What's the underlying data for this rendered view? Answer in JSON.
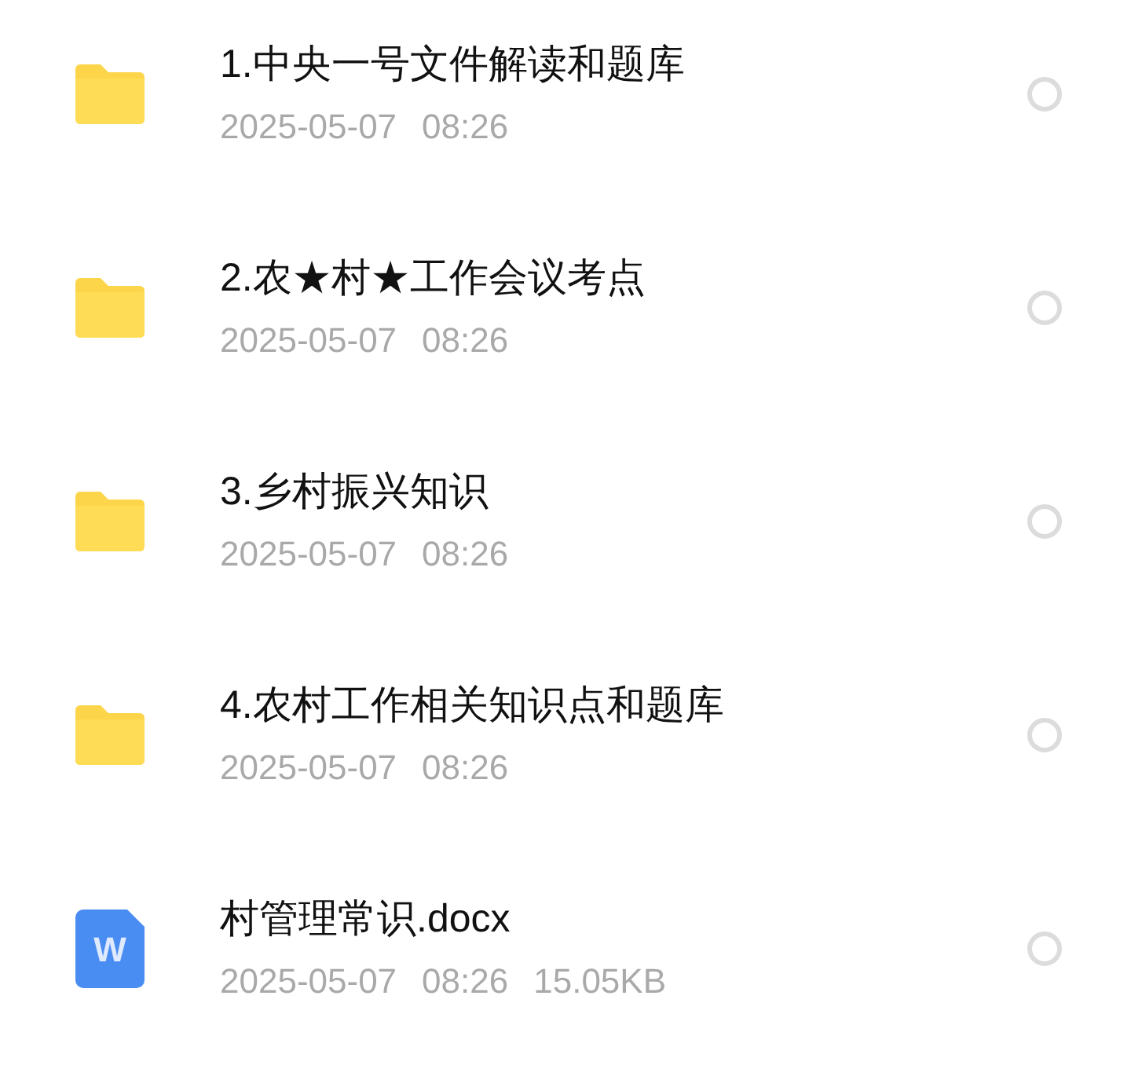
{
  "files": [
    {
      "kind": "folder",
      "name": "1.中央一号文件解读和题库",
      "date": "2025-05-07",
      "time": "08:26",
      "selected": false
    },
    {
      "kind": "folder",
      "name": "2.农★村★工作会议考点",
      "date": "2025-05-07",
      "time": "08:26",
      "selected": false
    },
    {
      "kind": "folder",
      "name": "3.乡村振兴知识",
      "date": "2025-05-07",
      "time": "08:26",
      "selected": false
    },
    {
      "kind": "folder",
      "name": "4.农村工作相关知识点和题库",
      "date": "2025-05-07",
      "time": "08:26",
      "selected": false
    },
    {
      "kind": "word",
      "icon_letter": "W",
      "name": "村管理常识.docx",
      "date": "2025-05-07",
      "time": "08:26",
      "size": "15.05KB",
      "selected": false
    }
  ]
}
